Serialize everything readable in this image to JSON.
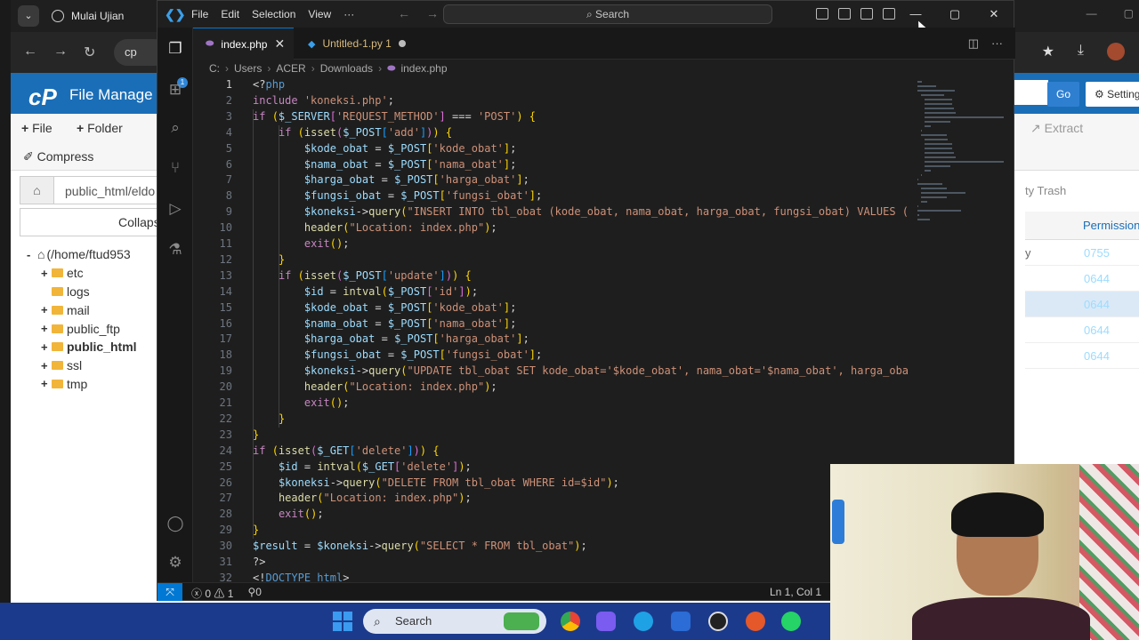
{
  "browser": {
    "tab_title": "Mulai Ujian",
    "address_text": "cp",
    "cpanel_title": "File Manage",
    "go_label": "Go",
    "settings_label": "Setting",
    "toolbar": {
      "file": "File",
      "folder": "Folder",
      "compress": "Compress",
      "extract": "Extract",
      "trash": "ty Trash"
    },
    "path_value": "public_html/eldo",
    "collapse_label": "Collaps",
    "tree": [
      {
        "label": "(/home/ftud953",
        "bold": false,
        "toggle": "-",
        "type": "home"
      },
      {
        "label": "etc",
        "bold": false,
        "toggle": "+",
        "type": "folder"
      },
      {
        "label": "logs",
        "bold": false,
        "toggle": "",
        "type": "folder"
      },
      {
        "label": "mail",
        "bold": false,
        "toggle": "+",
        "type": "folder"
      },
      {
        "label": "public_ftp",
        "bold": false,
        "toggle": "+",
        "type": "folder"
      },
      {
        "label": "public_html",
        "bold": true,
        "toggle": "+",
        "type": "folder"
      },
      {
        "label": "ssl",
        "bold": false,
        "toggle": "+",
        "type": "folder"
      },
      {
        "label": "tmp",
        "bold": false,
        "toggle": "+",
        "type": "folder"
      }
    ],
    "permissions_header": "Permissions",
    "permission_rows": [
      "0755",
      "0644",
      "0644",
      "0644",
      "0644"
    ],
    "row_prefix": "y"
  },
  "vscode": {
    "menu": [
      "File",
      "Edit",
      "Selection",
      "View",
      "···"
    ],
    "search_placeholder": "Search",
    "tabs": [
      {
        "label": "index.php",
        "active": true
      },
      {
        "label": "Untitled-1.py 1",
        "active": false
      }
    ],
    "breadcrumb": [
      "C:",
      "Users",
      "ACER",
      "Downloads",
      "index.php"
    ],
    "status": {
      "errors": "0",
      "warnings": "1",
      "ports": "0",
      "position": "Ln 1, Col 1"
    },
    "code_lines": [
      "<?php",
      "include 'koneksi.php';",
      "if ($_SERVER['REQUEST_METHOD'] === 'POST') {",
      "    if (isset($_POST['add'])) {",
      "        $kode_obat = $_POST['kode_obat'];",
      "        $nama_obat = $_POST['nama_obat'];",
      "        $harga_obat = $_POST['harga_obat'];",
      "        $fungsi_obat = $_POST['fungsi_obat'];",
      "        $koneksi->query(\"INSERT INTO tbl_obat (kode_obat, nama_obat, harga_obat, fungsi_obat) VALUES (",
      "        header(\"Location: index.php\");",
      "        exit();",
      "    }",
      "    if (isset($_POST['update'])) {",
      "        $id = intval($_POST['id']);",
      "        $kode_obat = $_POST['kode_obat'];",
      "        $nama_obat = $_POST['nama_obat'];",
      "        $harga_obat = $_POST['harga_obat'];",
      "        $fungsi_obat = $_POST['fungsi_obat'];",
      "        $koneksi->query(\"UPDATE tbl_obat SET kode_obat='$kode_obat', nama_obat='$nama_obat', harga_oba",
      "        header(\"Location: index.php\");",
      "        exit();",
      "    }",
      "}",
      "if (isset($_GET['delete'])) {",
      "    $id = intval($_GET['delete']);",
      "    $koneksi->query(\"DELETE FROM tbl_obat WHERE id=$id\");",
      "    header(\"Location: index.php\");",
      "    exit();",
      "}",
      "$result = $koneksi->query(\"SELECT * FROM tbl_obat\");",
      "?>",
      "<!DOCTYPE html>"
    ]
  },
  "taskbar": {
    "search_label": "Search"
  },
  "colors": {
    "accent": "#0078d4",
    "cpanel": "#1a6eb7",
    "taskbar": "#1c3a8c"
  }
}
